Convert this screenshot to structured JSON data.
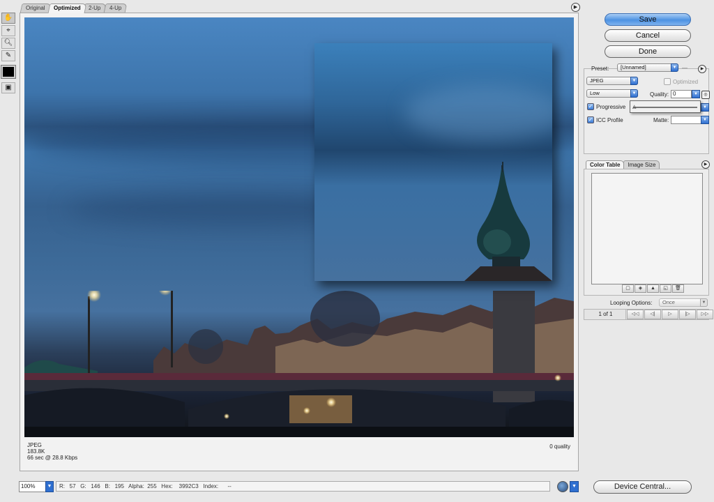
{
  "tabs": [
    {
      "label": "Original"
    },
    {
      "label": "Optimized"
    },
    {
      "label": "2-Up"
    },
    {
      "label": "4-Up"
    }
  ],
  "status": {
    "format": "JPEG",
    "size": "183.8K",
    "download": "66 sec @ 28.8 Kbps",
    "quality_text": "0 quality"
  },
  "bottom_bar": {
    "zoom": "100%",
    "info": "R:   57   G:   146   B:   195   Alpha:  255   Hex:    3992C3   Index:      --"
  },
  "actions": {
    "save": "Save",
    "cancel": "Cancel",
    "done": "Done",
    "device_central": "Device Central..."
  },
  "settings": {
    "preset_label": "Preset:",
    "preset_value": "[Unnamed]",
    "format_value": "JPEG",
    "optimized_label": "Optimized",
    "quality_preset": "Low",
    "quality_label": "Quality:",
    "quality_value": "0",
    "progressive_label": "Progressive",
    "icc_label": "ICC Profile",
    "matte_label": "Matte:"
  },
  "color_table": {
    "tab_color_table": "Color Table",
    "tab_image_size": "Image Size"
  },
  "animation": {
    "looping_label": "Looping Options:",
    "looping_value": "Once",
    "frame_count": "1 of 1"
  }
}
